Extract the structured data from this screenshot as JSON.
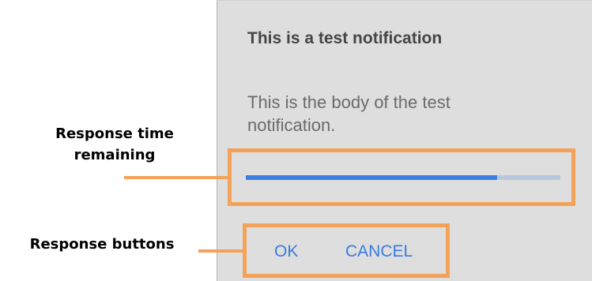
{
  "dialog": {
    "title": "This is a test notification",
    "body": "This is the body of the test notification.",
    "progress_remaining_fraction": 0.8,
    "buttons": {
      "ok": "OK",
      "cancel": "CANCEL"
    }
  },
  "annotations": {
    "response_time_line1": "Response time",
    "response_time_line2": "remaining",
    "response_buttons": "Response buttons"
  },
  "colors": {
    "dialog_background": "#dedede",
    "accent": "#3d7fe0",
    "track": "#b7c8de",
    "callout": "#f2a359"
  }
}
